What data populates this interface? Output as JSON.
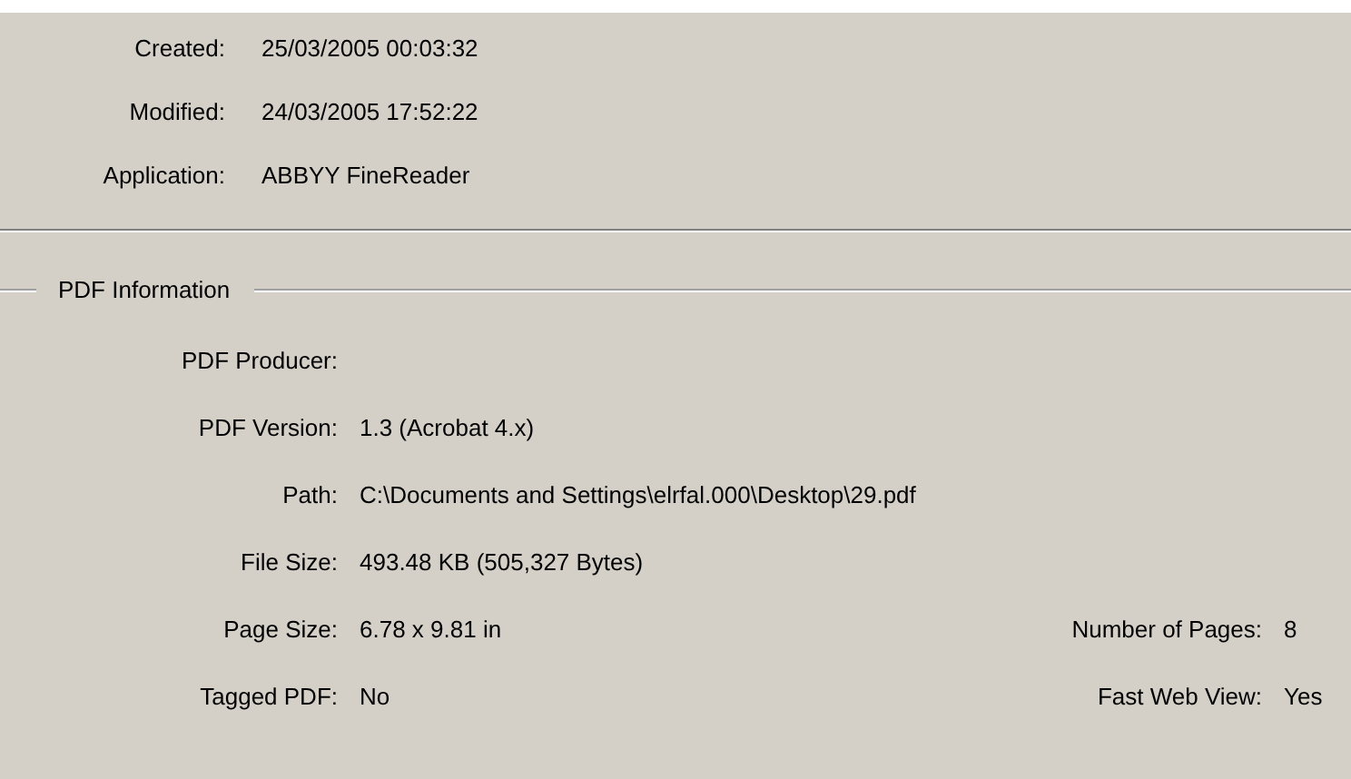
{
  "document_properties": [
    {
      "label": "Created:",
      "value": "25/03/2005 00:03:32"
    },
    {
      "label": "Modified:",
      "value": "24/03/2005 17:52:22"
    },
    {
      "label": "Application:",
      "value": "ABBYY FineReader"
    }
  ],
  "pdf_information": {
    "title": "PDF Information",
    "rows": [
      {
        "label": "PDF Producer:"
      },
      {
        "label": "PDF Version:",
        "value": "1.3 (Acrobat 4.x)"
      },
      {
        "label": "Path:",
        "value": "C:\\Documents and Settings\\elrfal.000\\Desktop\\29.pdf"
      },
      {
        "label": "File Size:",
        "value": "493.48 KB (505,327 Bytes)"
      },
      {
        "label": "Page Size:",
        "value": "6.78 x 9.81 in",
        "extra_label": "Number of Pages:",
        "extra_value": "8"
      },
      {
        "label": "Tagged PDF:",
        "value": "No",
        "extra_label": "Fast Web View:",
        "extra_value": "Yes"
      }
    ]
  }
}
